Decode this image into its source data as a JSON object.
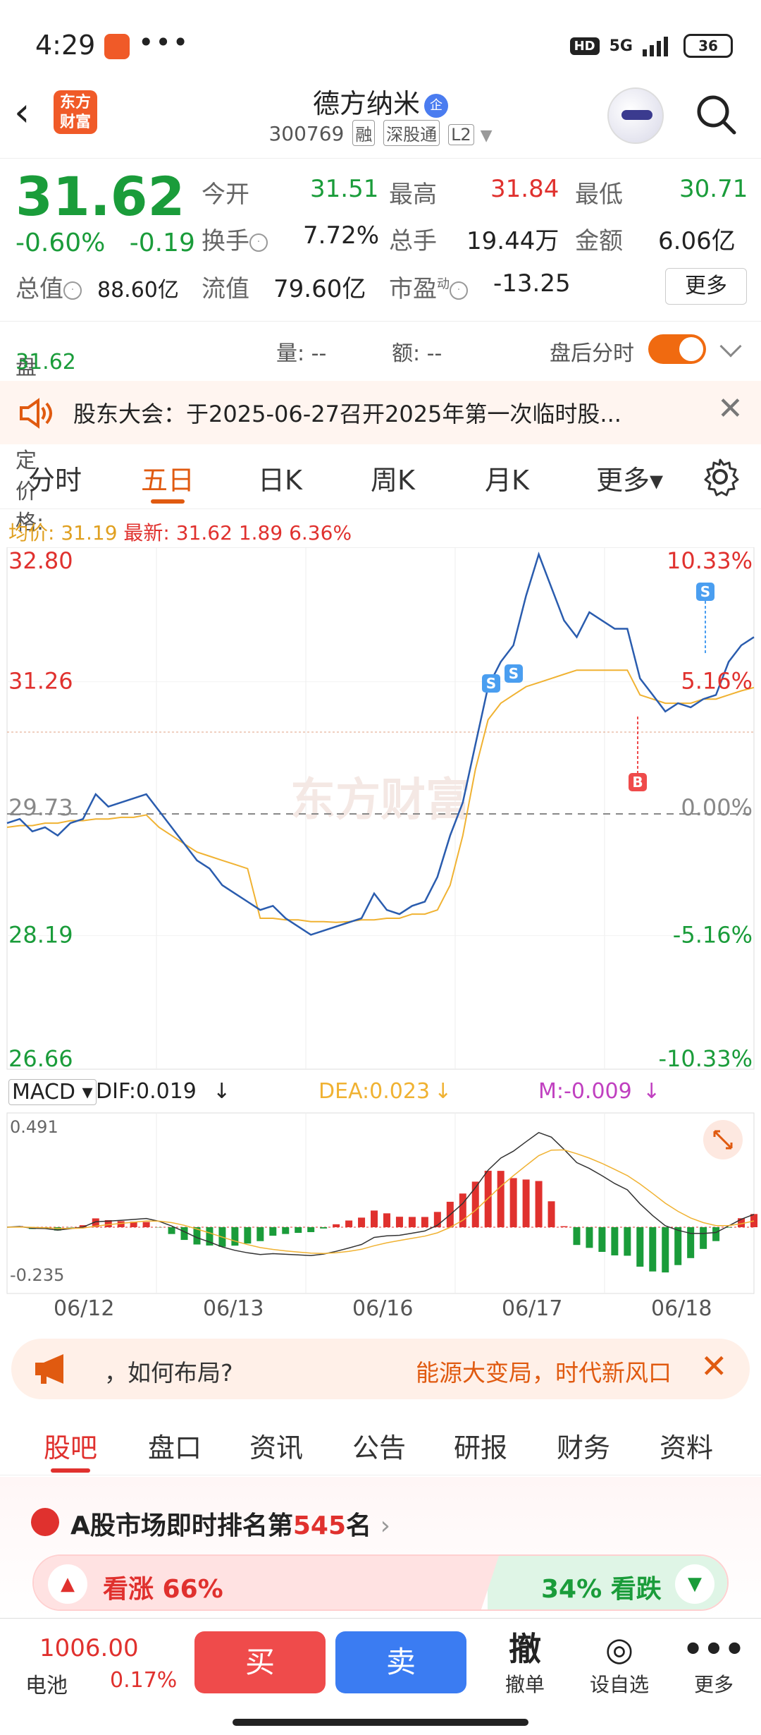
{
  "status": {
    "time": "4:29",
    "dots": "•••",
    "network": "5G",
    "hd": "HD",
    "battery": "36"
  },
  "header": {
    "back": "‹",
    "logo_line1": "东方",
    "logo_line2": "财富",
    "stock_name": "德方纳米",
    "qi_badge": "企",
    "code": "300769",
    "tags": [
      "融",
      "深股通",
      "L2"
    ]
  },
  "quote": {
    "price": "31.62",
    "change_pct": "-0.60%",
    "change_abs": "-0.19",
    "rows": [
      [
        {
          "label": "今开",
          "value": "31.51",
          "color": "green"
        },
        {
          "label": "最高",
          "value": "31.84",
          "color": "red"
        },
        {
          "label": "最低",
          "value": "30.71",
          "color": "green"
        }
      ],
      [
        {
          "label": "换手",
          "value": "7.72%",
          "color": ""
        },
        {
          "label": "总手",
          "value": "19.44万",
          "color": ""
        },
        {
          "label": "金额",
          "value": "6.06亿",
          "color": ""
        }
      ]
    ],
    "mv_label": "总值",
    "mv_value": "88.60亿",
    "fv_label": "流值",
    "fv_value": "79.60亿",
    "pe_label": "市盈",
    "pe_sup": "动",
    "pe_value": "-13.25",
    "more": "更多"
  },
  "after_hours": {
    "price_label": "盘后固定价格:",
    "price_value": "31.62",
    "vol_label": "量: --",
    "amt_label": "额: --",
    "toggle_label": "盘后分时"
  },
  "notice": {
    "text": "股东大会：于2025-06-27召开2025年第一次临时股...",
    "close": "✕"
  },
  "period_tabs": [
    "分时",
    "五日",
    "日K",
    "周K",
    "月K",
    "更多▾"
  ],
  "active_period": 1,
  "chart_stats": {
    "avg_label": "均价:",
    "avg_value": "31.19",
    "last_label": "最新:",
    "last_value": "31.62",
    "chg": "1.89",
    "chg_pct": "6.36%"
  },
  "chart_data": {
    "type": "line",
    "x": [
      "06/12",
      "06/13",
      "06/16",
      "06/17",
      "06/18"
    ],
    "y_ticks": [
      "32.80",
      "31.26",
      "29.73",
      "28.19",
      "26.66"
    ],
    "y_pct_ticks": [
      "10.33%",
      "5.16%",
      "0.00%",
      "-5.16%",
      "-10.33%"
    ],
    "ylim": [
      26.66,
      32.8
    ],
    "prev_close": 29.73,
    "series": [
      {
        "values": [
          29.55,
          29.6,
          29.45,
          29.5,
          29.4,
          29.55,
          29.6,
          29.9,
          29.75,
          29.8,
          29.85,
          29.9,
          29.7,
          29.5,
          29.3,
          29.1,
          29.0,
          28.8,
          28.7,
          28.6,
          28.5,
          28.55,
          28.4,
          28.3,
          28.2,
          28.25,
          28.3,
          28.35,
          28.4,
          28.7,
          28.5,
          28.45,
          28.55,
          28.6,
          28.9,
          29.4,
          29.8,
          30.5,
          31.2,
          31.5,
          31.7,
          32.3,
          32.8,
          32.4,
          32.0,
          31.8,
          32.1,
          32.0,
          31.9,
          31.9,
          31.3,
          31.1,
          30.9,
          31.0,
          30.95,
          31.05,
          31.1,
          31.5,
          31.7,
          31.8
        ]
      },
      {
        "values": [
          29.5,
          29.52,
          29.52,
          29.55,
          29.55,
          29.58,
          29.58,
          29.6,
          29.6,
          29.62,
          29.62,
          29.65,
          29.5,
          29.4,
          29.3,
          29.2,
          29.15,
          29.1,
          29.05,
          29.0,
          28.4,
          28.4,
          28.38,
          28.38,
          28.36,
          28.36,
          28.35,
          28.36,
          28.38,
          28.38,
          28.4,
          28.4,
          28.45,
          28.45,
          28.5,
          28.8,
          29.4,
          30.2,
          30.8,
          31.0,
          31.1,
          31.2,
          31.25,
          31.3,
          31.35,
          31.4,
          31.4,
          31.4,
          31.4,
          31.4,
          31.1,
          31.05,
          31.0,
          31.0,
          31.0,
          31.05,
          31.05,
          31.1,
          31.15,
          31.19
        ]
      }
    ],
    "macd": {
      "dif": "DIF:0.019",
      "dea": "DEA:0.023",
      "m": "M:-0.009",
      "top": "0.491",
      "bottom": "-0.235"
    }
  },
  "macd_label": "MACD",
  "ad": {
    "t1": "，如何布局?",
    "t2": "能源大变局，时代新风口",
    "close": "✕"
  },
  "section_tabs": [
    "股吧",
    "盘口",
    "资讯",
    "公告",
    "研报",
    "财务",
    "资料"
  ],
  "rank": {
    "prefix": "A股市场即时排名第",
    "num": "545",
    "suffix": "名",
    "up": "看涨 66%",
    "down": "34% 看跌"
  },
  "bottom": {
    "idx_value": "1006.00",
    "idx_name": "电池",
    "idx_chg": "0.17%",
    "buy": "买",
    "sell": "卖",
    "items": [
      {
        "icon": "撤",
        "label": "撤单"
      },
      {
        "icon": "◎",
        "label": "设自选"
      },
      {
        "icon": "•••",
        "label": "更多"
      }
    ]
  },
  "colors": {
    "up": "#e0312e",
    "down": "#1a9c3a",
    "accent": "#e05a10",
    "price_line": "#2a5cae",
    "avg_line": "#f0b232"
  }
}
